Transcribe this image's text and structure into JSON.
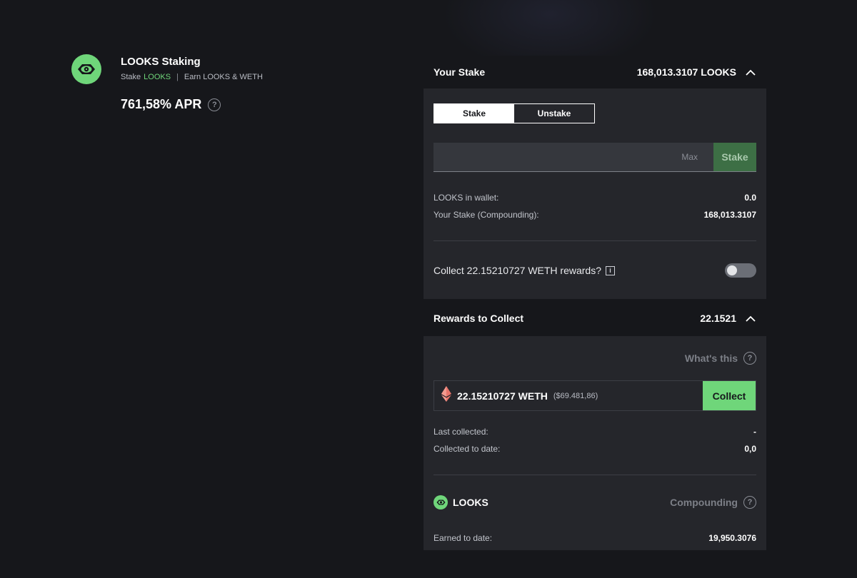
{
  "header": {
    "title": "LOOKS Staking",
    "stake_prefix": "Stake",
    "stake_token": "LOOKS",
    "separator": "|",
    "earn_text": "Earn LOOKS & WETH",
    "apr": "761,58% APR",
    "help_glyph": "?"
  },
  "stake_section": {
    "title": "Your Stake",
    "total": "168,013.3107 LOOKS",
    "tabs": [
      {
        "label": "Stake",
        "active": true
      },
      {
        "label": "Unstake",
        "active": false
      }
    ],
    "amount_value": "",
    "max_label": "Max",
    "stake_button": "Stake",
    "wallet_label": "LOOKS in wallet:",
    "wallet_value": "0.0",
    "compounding_label": "Your Stake (Compounding):",
    "compounding_value": "168,013.3107",
    "collect_toggle_label": "Collect 22.15210727 WETH rewards?",
    "info_glyph": "i",
    "collect_toggle_on": false
  },
  "rewards_section": {
    "title": "Rewards to Collect",
    "total": "22.1521",
    "whats_this": "What's this",
    "help_glyph": "?",
    "weth_amount": "22.15210727 WETH",
    "weth_usd": "($69.481,86)",
    "collect_button": "Collect",
    "last_collected_label": "Last collected:",
    "last_collected_value": "-",
    "collected_to_date_label": "Collected to date:",
    "collected_to_date_value": "0,0",
    "looks_label": "LOOKS",
    "compounding_label": "Compounding",
    "earned_label": "Earned to date:",
    "earned_value": "19,950.3076"
  },
  "colors": {
    "background": "#16171b",
    "card": "#25262b",
    "accent_green": "#6fd67a",
    "muted_green_button": "#3d6f45"
  },
  "icons": [
    "looks-logo-icon",
    "help-icon",
    "chevron-up-icon",
    "info-icon",
    "ethereum-icon"
  ]
}
